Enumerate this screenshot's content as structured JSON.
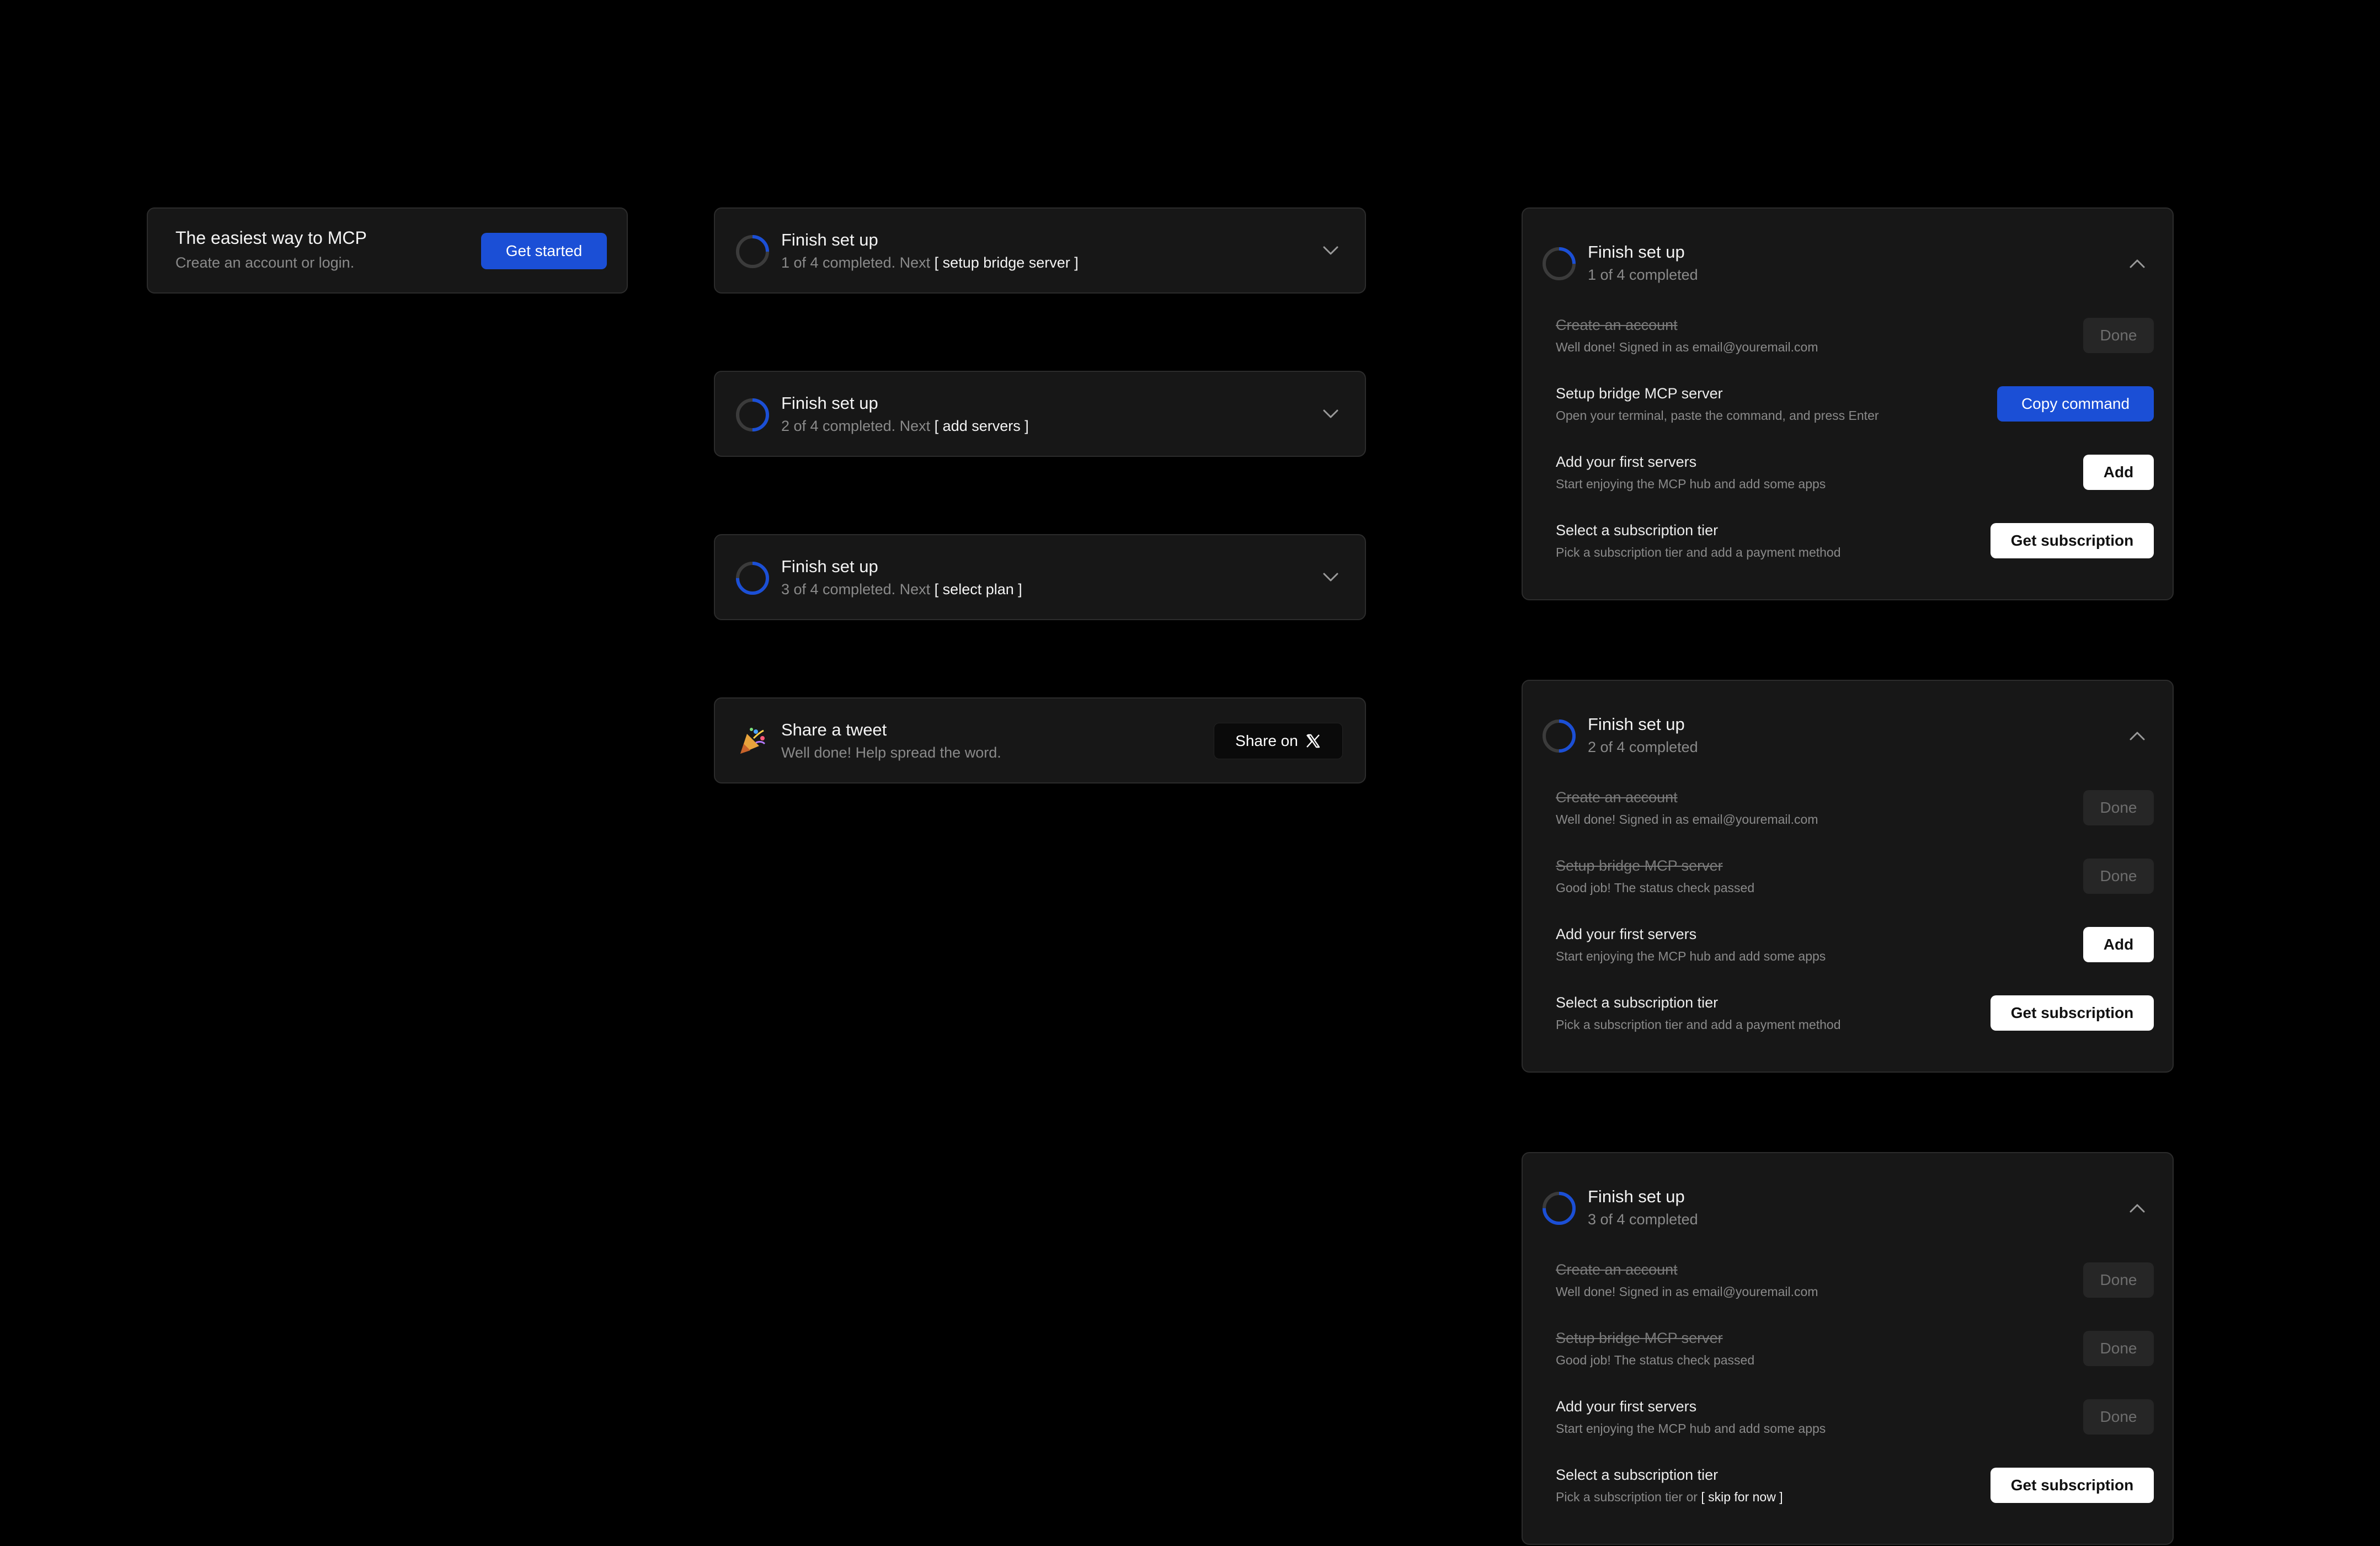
{
  "colors": {
    "accent": "#1b4fd6",
    "background": "#000000",
    "card": "#171717",
    "border": "#2c2c2c"
  },
  "intro": {
    "title": "The easiest way to MCP",
    "subtitle": "Create an account or login.",
    "cta": "Get started"
  },
  "collapsed": [
    {
      "title": "Finish set up",
      "status": "1 of 4 completed. Next",
      "next": "[ setup bridge server ]",
      "progress": 0.25
    },
    {
      "title": "Finish set up",
      "status": "2 of 4 completed. Next",
      "next": "[ add servers ]",
      "progress": 0.5
    },
    {
      "title": "Finish set up",
      "status": "3 of 4 completed. Next",
      "next": "[ select plan ]",
      "progress": 0.75
    }
  ],
  "tweet": {
    "icon": "party-popper-icon",
    "title": "Share a tweet",
    "subtitle": "Well done! Help spread the word.",
    "button": "Share on",
    "button_icon": "x-logo-icon"
  },
  "expanded": [
    {
      "title": "Finish set up",
      "status": "1 of 4 completed",
      "progress": 0.25,
      "tasks": [
        {
          "title": "Create an account",
          "desc": "Well done! Signed in as email@youremail.com",
          "button": "Done",
          "state": "done"
        },
        {
          "title": "Setup bridge MCP server",
          "desc": "Open your terminal, paste the command, and press Enter",
          "button": "Copy command",
          "state": "primary"
        },
        {
          "title": "Add your first servers",
          "desc": "Start enjoying the MCP hub and add some apps",
          "button": "Add",
          "state": "action"
        },
        {
          "title": "Select a subscription tier",
          "desc": "Pick a subscription tier and add a payment method",
          "button": "Get subscription",
          "state": "action"
        }
      ]
    },
    {
      "title": "Finish set up",
      "status": "2 of 4 completed",
      "progress": 0.5,
      "tasks": [
        {
          "title": "Create an account",
          "desc": "Well done! Signed in as email@youremail.com",
          "button": "Done",
          "state": "done"
        },
        {
          "title": "Setup bridge MCP server",
          "desc": "Good job! The status check passed",
          "button": "Done",
          "state": "done"
        },
        {
          "title": "Add your first servers",
          "desc": "Start enjoying the MCP hub and add some apps",
          "button": "Add",
          "state": "action"
        },
        {
          "title": "Select a subscription tier",
          "desc": "Pick a subscription tier and add a payment method",
          "button": "Get subscription",
          "state": "action"
        }
      ]
    },
    {
      "title": "Finish set up",
      "status": "3 of 4 completed",
      "progress": 0.75,
      "tasks": [
        {
          "title": "Create an account",
          "desc": "Well done! Signed in as email@youremail.com",
          "button": "Done",
          "state": "done"
        },
        {
          "title": "Setup bridge MCP server",
          "desc": "Good job! The status check passed",
          "button": "Done",
          "state": "done"
        },
        {
          "title": "Add your first servers",
          "desc": "Start enjoying the MCP hub and add some apps",
          "button": "Done",
          "state": "done-active"
        },
        {
          "title": "Select a subscription tier",
          "desc": "Pick a subscription tier or",
          "desc_link": "[ skip for now ]",
          "button": "Get subscription",
          "state": "action"
        }
      ]
    }
  ]
}
